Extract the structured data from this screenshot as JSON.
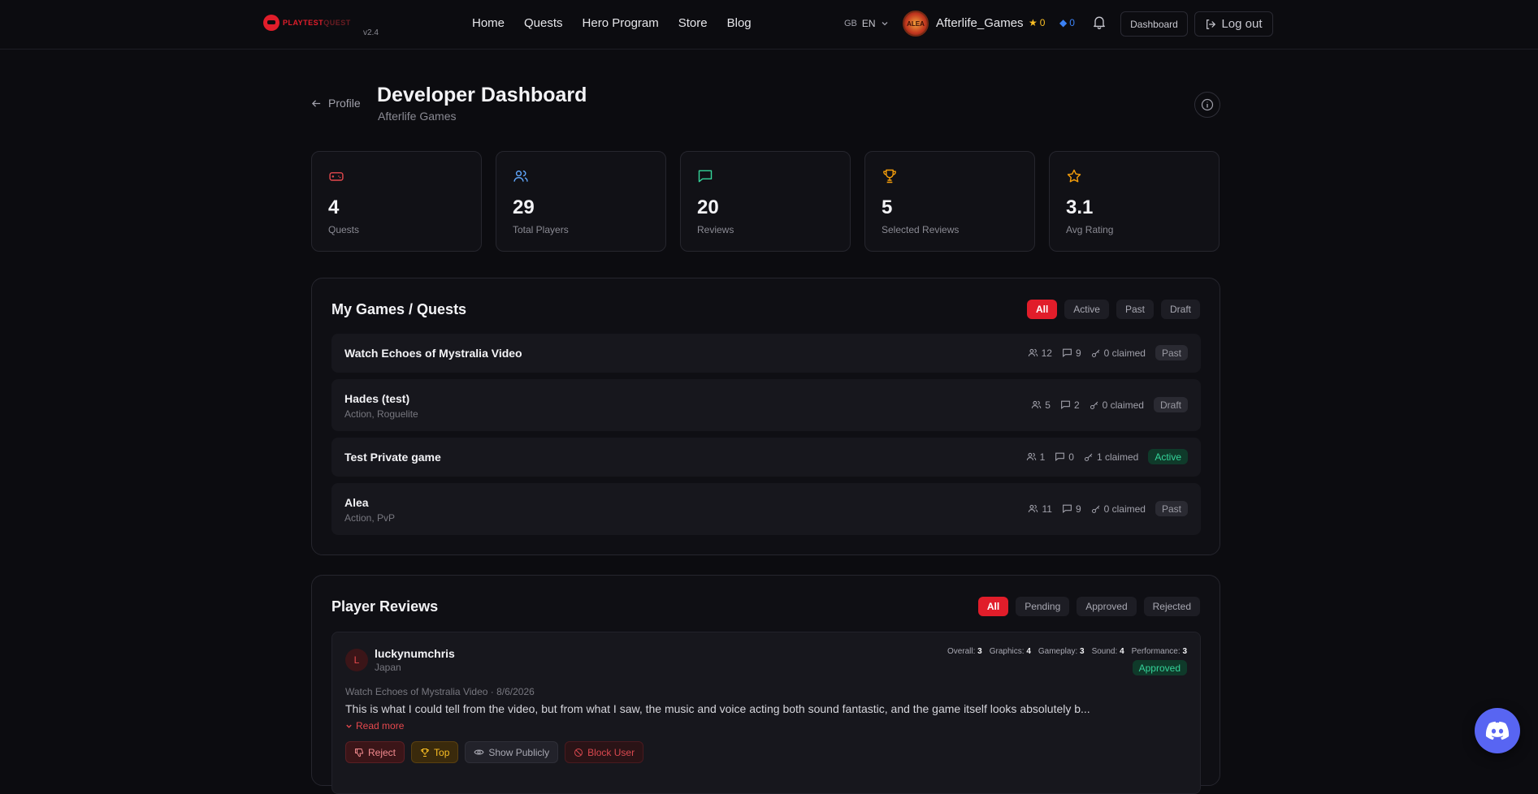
{
  "nav": {
    "logo_text": "PLAYTEST",
    "logo_text2": "QUEST",
    "version": "v2.4",
    "links": [
      "Home",
      "Quests",
      "Hero Program",
      "Store",
      "Blog"
    ],
    "lang_flag": "GB",
    "lang": "EN",
    "avatar_text": "ALEA",
    "username": "Afterlife_Games",
    "stars": "0",
    "gems": "0",
    "dashboard_label": "Dashboard",
    "logout_label": "Log out"
  },
  "header": {
    "back_label": "Profile",
    "title": "Developer Dashboard",
    "subtitle": "Afterlife Games"
  },
  "stats": [
    {
      "value": "4",
      "label": "Quests",
      "icon": "gamepad-icon",
      "color": "#e5484d"
    },
    {
      "value": "29",
      "label": "Total Players",
      "icon": "users-icon",
      "color": "#60a5fa"
    },
    {
      "value": "20",
      "label": "Reviews",
      "icon": "message-icon",
      "color": "#34d399"
    },
    {
      "value": "5",
      "label": "Selected Reviews",
      "icon": "trophy-icon",
      "color": "#f59e0b"
    },
    {
      "value": "3.1",
      "label": "Avg Rating",
      "icon": "star-icon",
      "color": "#f59e0b"
    }
  ],
  "quests_panel": {
    "title": "My Games / Quests",
    "filters": [
      "All",
      "Active",
      "Past",
      "Draft"
    ],
    "rows": [
      {
        "name": "Watch Echoes of Mystralia Video",
        "genre": "",
        "players": "12",
        "reviews": "9",
        "claimed": "0 claimed",
        "status": "Past"
      },
      {
        "name": "Hades (test)",
        "genre": "Action, Roguelite",
        "players": "5",
        "reviews": "2",
        "claimed": "0 claimed",
        "status": "Draft"
      },
      {
        "name": "Test Private game",
        "genre": "",
        "players": "1",
        "reviews": "0",
        "claimed": "1 claimed",
        "status": "Active"
      },
      {
        "name": "Alea",
        "genre": "Action, PvP",
        "players": "11",
        "reviews": "9",
        "claimed": "0 claimed",
        "status": "Past"
      }
    ]
  },
  "reviews_panel": {
    "title": "Player Reviews",
    "filters": [
      "All",
      "Pending",
      "Approved",
      "Rejected"
    ],
    "review": {
      "initial": "L",
      "name": "luckynumchris",
      "country": "Japan",
      "scores": [
        {
          "label": "Overall:",
          "value": "3"
        },
        {
          "label": "Graphics:",
          "value": "4"
        },
        {
          "label": "Gameplay:",
          "value": "3"
        },
        {
          "label": "Sound:",
          "value": "4"
        },
        {
          "label": "Performance:",
          "value": "3"
        }
      ],
      "status": "Approved",
      "context": "Watch Echoes of Mystralia Video · 8/6/2026",
      "text": "This is what I could tell from the video, but from what I saw, the music and voice acting both sound fantastic, and the game itself looks absolutely b...",
      "read_more": "Read more",
      "actions": {
        "reject": "Reject",
        "top": "Top",
        "show": "Show Publicly",
        "block": "Block User"
      }
    }
  },
  "colors": {
    "accent": "#e11d2a",
    "success": "#34d399",
    "discord": "#5865f2"
  }
}
